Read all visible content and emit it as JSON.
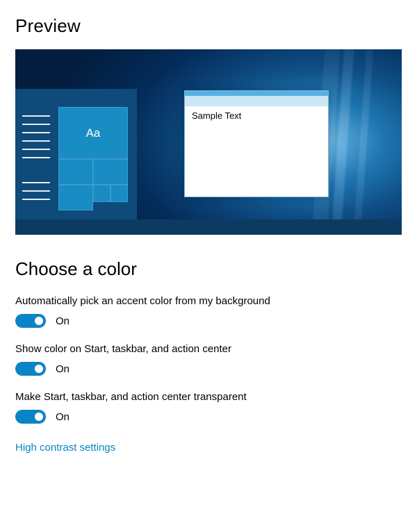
{
  "headings": {
    "preview": "Preview",
    "choose_color": "Choose a color"
  },
  "preview": {
    "tile_text": "Aa",
    "window_sample_text": "Sample Text"
  },
  "settings": {
    "auto_accent": {
      "label": "Automatically pick an accent color from my background",
      "state": "On"
    },
    "show_color": {
      "label": "Show color on Start, taskbar, and action center",
      "state": "On"
    },
    "transparent": {
      "label": "Make Start, taskbar, and action center transparent",
      "state": "On"
    }
  },
  "links": {
    "high_contrast": "High contrast settings"
  },
  "colors": {
    "accent": "#0a84c6"
  }
}
